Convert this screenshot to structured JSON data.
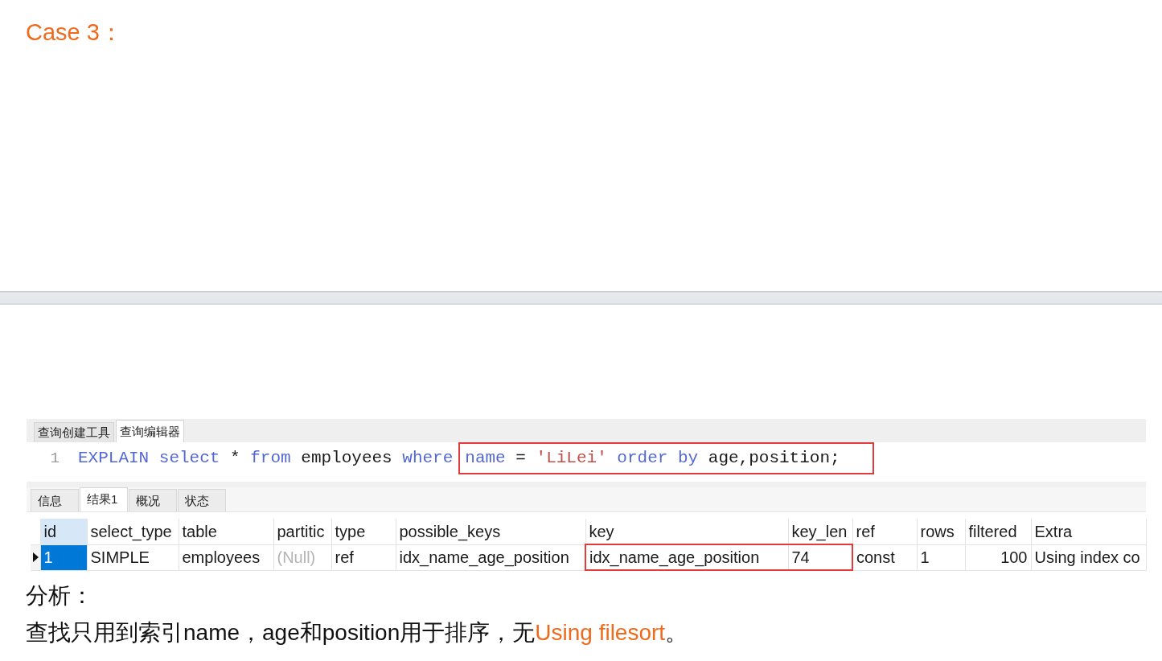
{
  "title": "Case 3：",
  "query_window": {
    "tabs": [
      {
        "label": "查询创建工具",
        "selected": false
      },
      {
        "label": "查询编辑器",
        "selected": true
      }
    ],
    "editor": {
      "lines": [
        {
          "number": "1",
          "groups": [
            {
              "highlighted": false,
              "tokens": [
                {
                  "text": "EXPLAIN select",
                  "kind": "keyword"
                },
                {
                  "text": " * ",
                  "kind": "plain"
                },
                {
                  "text": "from",
                  "kind": "keyword"
                },
                {
                  "text": " employees ",
                  "kind": "plain"
                },
                {
                  "text": "where",
                  "kind": "keyword"
                }
              ]
            },
            {
              "highlighted": true,
              "tokens": [
                {
                  "text": "name",
                  "kind": "keyword"
                },
                {
                  "text": " = ",
                  "kind": "plain"
                },
                {
                  "text": "'LiLei'",
                  "kind": "string"
                },
                {
                  "text": " order by",
                  "kind": "keyword"
                },
                {
                  "text": " age,position;",
                  "kind": "plain"
                }
              ]
            }
          ]
        }
      ]
    },
    "result_tabs": [
      {
        "label": "信息",
        "selected": false
      },
      {
        "label": "结果1",
        "selected": true
      },
      {
        "label": "概况",
        "selected": false
      },
      {
        "label": "状态",
        "selected": false
      }
    ],
    "result_grid": {
      "columns": [
        {
          "label": "id",
          "selected": true
        },
        {
          "label": "select_type",
          "selected": false
        },
        {
          "label": "table",
          "selected": false
        },
        {
          "label": "partitic",
          "selected": false
        },
        {
          "label": "type",
          "selected": false
        },
        {
          "label": "possible_keys",
          "selected": false
        },
        {
          "label": "key",
          "selected": false
        },
        {
          "label": "key_len",
          "selected": false
        },
        {
          "label": "ref",
          "selected": false
        },
        {
          "label": "rows",
          "selected": false
        },
        {
          "label": "filtered",
          "selected": false
        },
        {
          "label": "Extra",
          "selected": false
        }
      ],
      "rows": [
        {
          "current": true,
          "cells": [
            {
              "text": "1",
              "kind": "text",
              "selected": true,
              "highlighted": false
            },
            {
              "text": "SIMPLE",
              "kind": "text",
              "selected": false,
              "highlighted": false
            },
            {
              "text": "employees",
              "kind": "text",
              "selected": false,
              "highlighted": false
            },
            {
              "text": "(Null)",
              "kind": "null",
              "selected": false,
              "highlighted": false
            },
            {
              "text": "ref",
              "kind": "text",
              "selected": false,
              "highlighted": false
            },
            {
              "text": "idx_name_age_position",
              "kind": "text",
              "selected": false,
              "highlighted": false
            },
            {
              "text": "idx_name_age_position",
              "kind": "text",
              "selected": false,
              "highlighted": true
            },
            {
              "text": "74",
              "kind": "text",
              "selected": false,
              "highlighted": true
            },
            {
              "text": "const",
              "kind": "text",
              "selected": false,
              "highlighted": false
            },
            {
              "text": "1",
              "kind": "text",
              "selected": false,
              "highlighted": false
            },
            {
              "text": "100",
              "kind": "number",
              "selected": false,
              "highlighted": false
            },
            {
              "text": "Using index co",
              "kind": "text",
              "selected": false,
              "highlighted": false
            }
          ]
        }
      ]
    }
  },
  "analysis": {
    "heading": "分析：",
    "sentence": [
      {
        "text": "查找只用到索引name，age和position用于排序，无",
        "highlighted": false
      },
      {
        "text": "Using filesort",
        "highlighted": true
      },
      {
        "text": "。",
        "highlighted": false
      }
    ]
  }
}
